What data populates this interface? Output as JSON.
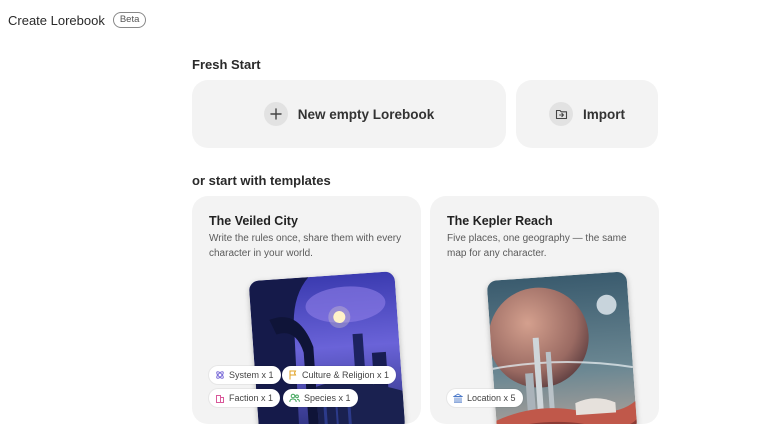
{
  "header": {
    "title": "Create Lorebook",
    "badge": "Beta"
  },
  "fresh_start": {
    "heading": "Fresh Start",
    "new_label": "New empty Lorebook",
    "import_label": "Import"
  },
  "templates": {
    "heading": "or start with templates",
    "cards": [
      {
        "title": "The Veiled City",
        "description": "Write the rules once, share them with every character in your world.",
        "tags": [
          {
            "label": "System x 1",
            "icon": "atom-icon",
            "color": "#7a6bd8"
          },
          {
            "label": "Culture & Religion x 1",
            "icon": "flag-icon",
            "color": "#e0a020"
          },
          {
            "label": "Faction x 1",
            "icon": "building-icon",
            "color": "#d9589a"
          },
          {
            "label": "Species x 1",
            "icon": "people-icon",
            "color": "#3fa55a"
          }
        ]
      },
      {
        "title": "The Kepler Reach",
        "description": "Five places, one geography — the same map for any character.",
        "tags": [
          {
            "label": "Location x 5",
            "icon": "landmark-icon",
            "color": "#4a78c8"
          }
        ]
      }
    ]
  }
}
